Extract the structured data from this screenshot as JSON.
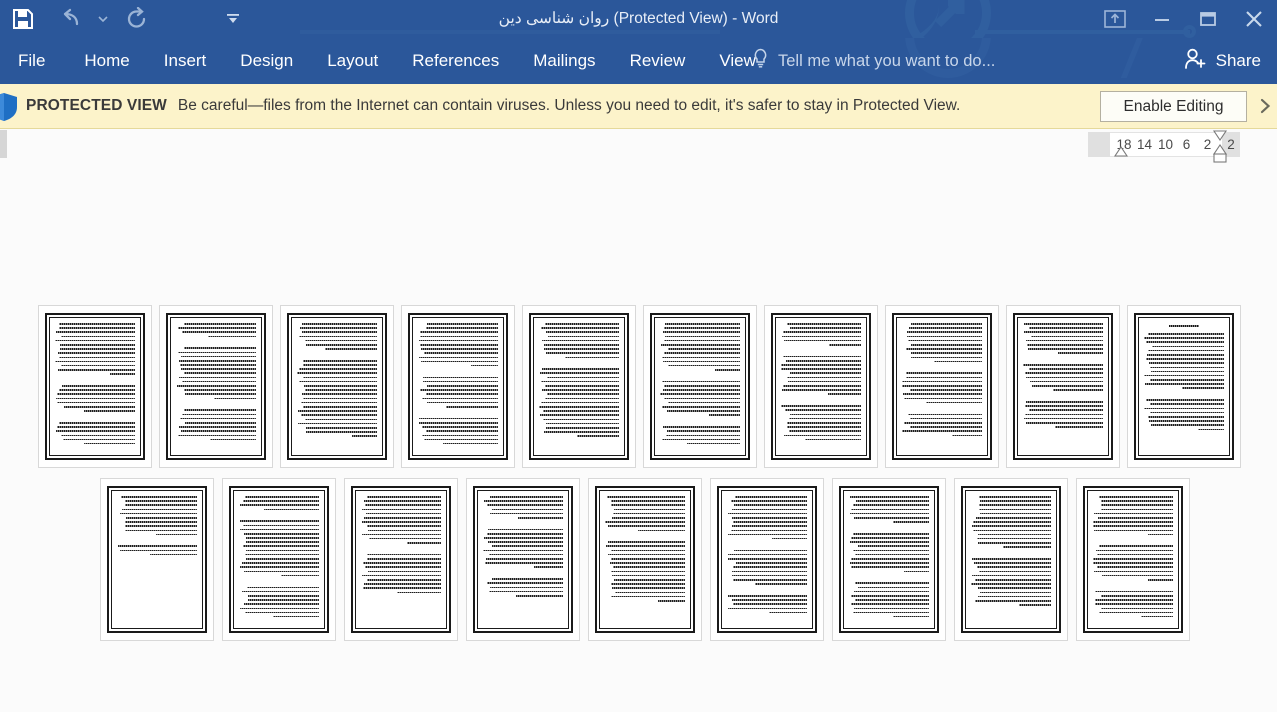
{
  "window": {
    "title": "روان شناسی دین (Protected View) - Word",
    "quick_access": {
      "save_icon": "save-icon",
      "undo_icon": "undo-icon",
      "redo_icon": "redo-icon",
      "customize_icon": "chevron-down-icon"
    },
    "controls": {
      "ribbon_display_icon": "ribbon-display-options-icon",
      "minimize_icon": "minimize-icon",
      "restore_icon": "restore-icon",
      "close_icon": "close-icon"
    },
    "accent_color": "#2b579a"
  },
  "ribbon": {
    "tabs": [
      {
        "label": "File",
        "id": "file"
      },
      {
        "label": "Home",
        "id": "home"
      },
      {
        "label": "Insert",
        "id": "insert"
      },
      {
        "label": "Design",
        "id": "design"
      },
      {
        "label": "Layout",
        "id": "layout"
      },
      {
        "label": "References",
        "id": "references"
      },
      {
        "label": "Mailings",
        "id": "mailings"
      },
      {
        "label": "Review",
        "id": "review"
      },
      {
        "label": "View",
        "id": "view"
      }
    ],
    "tell_me": {
      "placeholder": "Tell me what you want to do...",
      "icon": "lightbulb-icon"
    },
    "share": {
      "label": "Share",
      "icon": "person-add-icon"
    }
  },
  "protected_view": {
    "shield_icon": "shield-icon",
    "label": "PROTECTED VIEW",
    "message": "Be careful—files from the Internet can contain viruses. Unless you need to edit, it's safer to stay in Protected View.",
    "enable_button": "Enable Editing",
    "close_icon": "close-banner-icon",
    "background_color": "#fcf3ca"
  },
  "ruler": {
    "numbers": [
      "18",
      "14",
      "10",
      "6",
      "2",
      "2"
    ],
    "first_line_indent_marker": "first-line-indent-marker",
    "hanging_indent_marker": "hanging-indent-marker",
    "left_indent_marker": "left-indent-marker"
  },
  "document": {
    "zoom_view": "multiple-pages",
    "page_count": 19,
    "rows": [
      {
        "id": "row-1",
        "pages": [
          {
            "n": 1,
            "has_title": false,
            "lines": 26,
            "para_breaks": [
              13,
              20
            ]
          },
          {
            "n": 2,
            "has_title": false,
            "lines": 25,
            "para_breaks": [
              4,
              17
            ]
          },
          {
            "n": 3,
            "has_title": false,
            "lines": 26,
            "para_breaks": [
              7
            ]
          },
          {
            "n": 4,
            "has_title": false,
            "lines": 26,
            "para_breaks": [
              11,
              19
            ]
          },
          {
            "n": 5,
            "has_title": false,
            "lines": 26,
            "para_breaks": [
              9
            ]
          },
          {
            "n": 6,
            "has_title": false,
            "lines": 26,
            "para_breaks": [
              12,
              21
            ]
          },
          {
            "n": 7,
            "has_title": false,
            "lines": 25,
            "para_breaks": [
              6,
              16
            ]
          },
          {
            "n": 8,
            "has_title": false,
            "lines": 24,
            "para_breaks": [
              10,
              18
            ]
          },
          {
            "n": 9,
            "has_title": false,
            "lines": 22,
            "para_breaks": [
              8,
              15
            ]
          },
          {
            "n": 10,
            "has_title": true,
            "lines": 22,
            "para_breaks": [
              14
            ]
          }
        ]
      },
      {
        "id": "row-2",
        "pages": [
          {
            "n": 11,
            "has_title": false,
            "lines": 13,
            "para_breaks": [
              10
            ]
          },
          {
            "n": 12,
            "has_title": false,
            "lines": 26,
            "para_breaks": [
              4,
              18
            ]
          },
          {
            "n": 13,
            "has_title": false,
            "lines": 22,
            "para_breaks": [
              12
            ]
          },
          {
            "n": 14,
            "has_title": false,
            "lines": 21,
            "para_breaks": [
              6,
              16
            ]
          },
          {
            "n": 15,
            "has_title": false,
            "lines": 24,
            "para_breaks": [
              9
            ]
          },
          {
            "n": 16,
            "has_title": false,
            "lines": 25,
            "para_breaks": [
              11,
              20
            ]
          },
          {
            "n": 17,
            "has_title": false,
            "lines": 26,
            "para_breaks": [
              7,
              17
            ]
          },
          {
            "n": 18,
            "has_title": false,
            "lines": 25,
            "para_breaks": [
              13
            ]
          },
          {
            "n": 19,
            "has_title": false,
            "lines": 26,
            "para_breaks": [
              10,
              19
            ]
          }
        ]
      }
    ]
  }
}
